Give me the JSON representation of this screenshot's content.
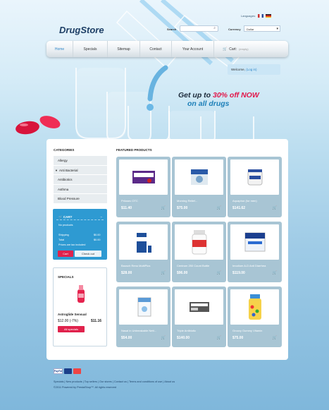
{
  "header": {
    "logo": "DrugStore",
    "languages_label": "Languages:",
    "search_label": "Search",
    "currency_label": "Currency",
    "currency_value": "Dollar"
  },
  "nav": {
    "items": [
      "Home",
      "Specials",
      "Sitemap",
      "Contact",
      "Your Account"
    ],
    "cart_label": "Cart:",
    "cart_status": "(empty)"
  },
  "welcome": {
    "text": "Welcome,",
    "link": "(Log in)"
  },
  "promo": {
    "line1_a": "Get up to ",
    "line1_b": "30% off",
    "line1_c": " NOW",
    "line2": "on all drugs"
  },
  "categories": {
    "title": "CATEGORIES",
    "items": [
      "Allergy",
      "Anti Bacterial",
      "Antibiotics",
      "Asthma",
      "Blood Pressure"
    ]
  },
  "cart": {
    "title": "CART",
    "toggle": "–",
    "empty": "No products",
    "shipping_label": "Shipping",
    "shipping_value": "$0.00",
    "total_label": "Total",
    "total_value": "$0.00",
    "tax_note": "Prices are tax included",
    "cart_button": "Cart",
    "checkout_button": "Check out"
  },
  "specials": {
    "title": "SPECIALS",
    "product_name": "Astroglide Sensual",
    "old_price": "$12.00 (-7%)",
    "new_price": "$11.16",
    "all_button": "All specials"
  },
  "featured": {
    "title": "FEATURED PRODUCTS",
    "products": [
      {
        "name": "Prilosec OTC",
        "price": "$11.40"
      },
      {
        "name": "Morning Relief...",
        "price": "$75.00"
      },
      {
        "name": "Aquaphor (for men)",
        "price": "$141.62"
      },
      {
        "name": "Bausch Renu MultiPlus",
        "price": "$28.00"
      },
      {
        "name": "Centrum 250 Count Bottle",
        "price": "$96.00"
      },
      {
        "name": "Imodium A-D Anti Diarrhea",
        "price": "$119.00"
      },
      {
        "name": "Nasal in Unbreakable Nett...",
        "price": "$54.00"
      },
      {
        "name": "Triple Antibiotic",
        "price": "$140.00"
      },
      {
        "name": "Groovy Gummy Vitamin",
        "price": "$75.00"
      }
    ]
  },
  "footer": {
    "links": [
      "Specials",
      "New products",
      "Top sellers",
      "Our stores",
      "Contact us",
      "Terms and conditions of use",
      "About us"
    ],
    "copyright": "©2011 Powered by PrestaShop™. All rights reserved"
  },
  "colors": {
    "accent": "#2e9ad2",
    "sale": "#e0224c",
    "nav_active": "#2f86c8"
  }
}
